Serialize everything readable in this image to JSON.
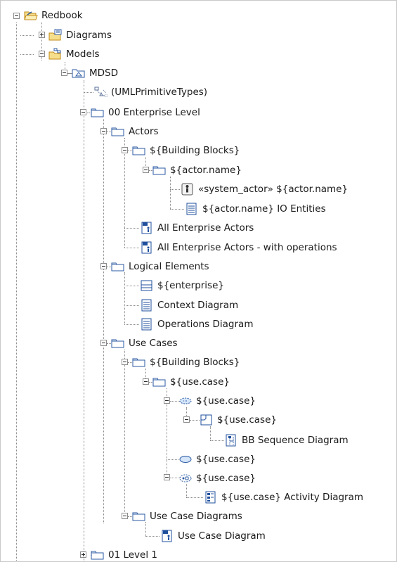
{
  "tree": {
    "nodes": [
      {
        "label": "Redbook",
        "icon": "project-folder-icon"
      },
      {
        "label": "Diagrams",
        "icon": "diagrams-folder-icon"
      },
      {
        "label": "Models",
        "icon": "models-folder-icon"
      },
      {
        "label": "MDSD",
        "icon": "model-icon"
      },
      {
        "label": "(UMLPrimitiveTypes)",
        "icon": "model-library-icon"
      },
      {
        "label": "00 Enterprise Level",
        "icon": "package-icon"
      },
      {
        "label": "Actors",
        "icon": "package-icon"
      },
      {
        "label": "${Building Blocks}",
        "icon": "package-icon"
      },
      {
        "label": "${actor.name}",
        "icon": "package-icon"
      },
      {
        "label": "«system_actor» ${actor.name}",
        "icon": "actor-icon"
      },
      {
        "label": "${actor.name} IO Entities",
        "icon": "diagram-icon"
      },
      {
        "label": "All Enterprise Actors",
        "icon": "class-diagram-icon"
      },
      {
        "label": "All Enterprise Actors - with operations",
        "icon": "class-diagram-icon"
      },
      {
        "label": "Logical Elements",
        "icon": "package-icon"
      },
      {
        "label": "${enterprise}",
        "icon": "component-icon"
      },
      {
        "label": "Context Diagram",
        "icon": "diagram-icon"
      },
      {
        "label": "Operations Diagram",
        "icon": "diagram-icon"
      },
      {
        "label": "Use Cases",
        "icon": "package-icon"
      },
      {
        "label": "${Building Blocks}",
        "icon": "package-icon"
      },
      {
        "label": "${use.case}",
        "icon": "package-icon"
      },
      {
        "label": "${use.case}",
        "icon": "use-case-dashed-icon"
      },
      {
        "label": "${use.case}",
        "icon": "interaction-icon"
      },
      {
        "label": "BB Sequence Diagram",
        "icon": "sequence-diagram-icon"
      },
      {
        "label": "${use.case}",
        "icon": "use-case-icon"
      },
      {
        "label": "${use.case}",
        "icon": "activity-icon"
      },
      {
        "label": "${use.case} Activity Diagram",
        "icon": "activity-diagram-icon"
      },
      {
        "label": "Use Case Diagrams",
        "icon": "package-icon"
      },
      {
        "label": "Use Case Diagram",
        "icon": "class-diagram-icon"
      },
      {
        "label": "01 Level 1",
        "icon": "package-icon"
      }
    ]
  },
  "colors": {
    "folder_fill": "#f6df8c",
    "folder_stroke": "#c08a17",
    "package_stroke": "#2b5aa3",
    "diagram_stroke": "#1f4f9c",
    "tree_line": "#8a8a8a"
  }
}
